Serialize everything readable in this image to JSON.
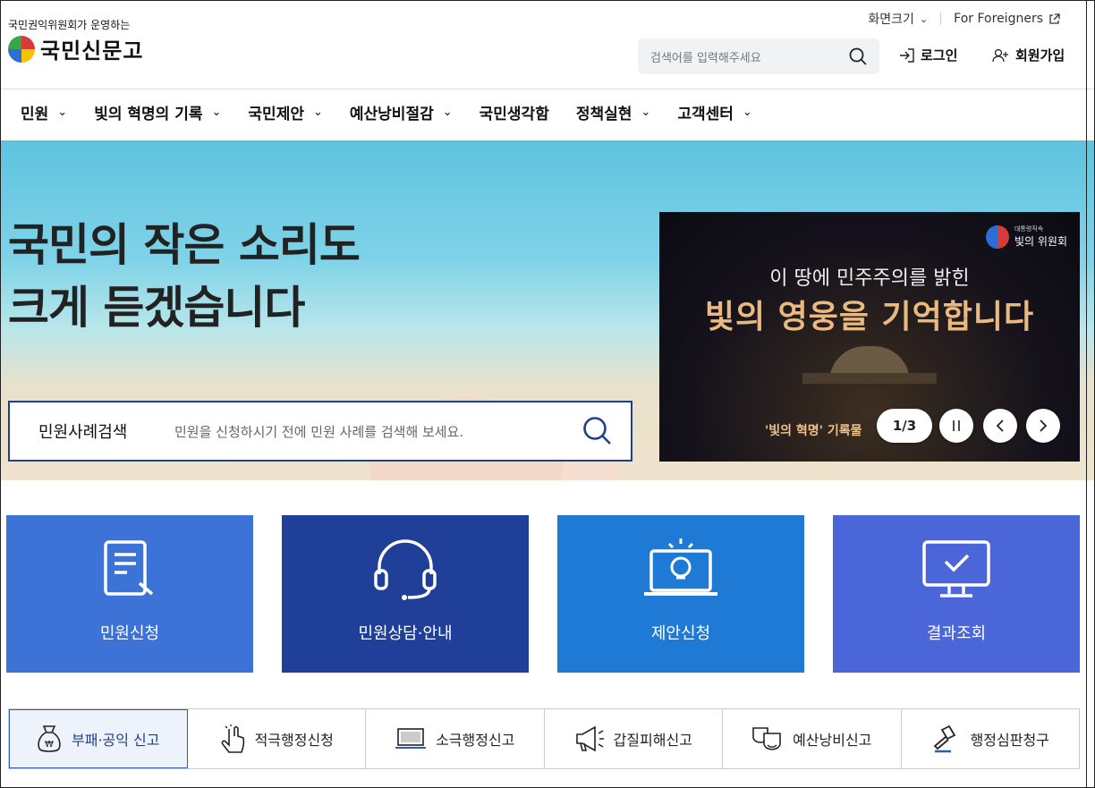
{
  "header": {
    "tagline": "국민권익위원회가 운영하는",
    "site_name": "국민신문고",
    "font_size_label": "화면크기",
    "foreigners_label": "For Foreigners",
    "search_placeholder": "검색어를 입력해주세요",
    "login_label": "로그인",
    "signup_label": "회원가입"
  },
  "nav": {
    "items": [
      {
        "label": "민원"
      },
      {
        "label": "빛의 혁명의 기록"
      },
      {
        "label": "국민제안"
      },
      {
        "label": "예산낭비절감"
      },
      {
        "label": "국민생각함"
      },
      {
        "label": "정책실현"
      },
      {
        "label": "고객센터"
      }
    ]
  },
  "hero": {
    "line1": "국민의 작은 소리도",
    "line2": "크게 듣겠습니다",
    "case_search_label": "민원사례검색",
    "case_search_placeholder": "민원을 신청하시기 전에 민원 사례를 검색해 보세요."
  },
  "banner": {
    "org_small": "대통령직속",
    "org_name": "빛의 위원회",
    "line1": "이 땅에 민주주의를 밝힌",
    "line2": "빛의 영웅을 기억합니다",
    "caption": "'빛의 혁명' 기록물",
    "pager": "1/3"
  },
  "tiles": [
    {
      "label": "민원신청",
      "color": "#3d72d6"
    },
    {
      "label": "민원상담·안내",
      "color": "#1f3f99"
    },
    {
      "label": "제안신청",
      "color": "#1f7ad6"
    },
    {
      "label": "결과조회",
      "color": "#4a66d9"
    }
  ],
  "quick": [
    {
      "label": "부패·공익 신고",
      "icon": "money-bag-icon"
    },
    {
      "label": "적극행정신청",
      "icon": "pointer-hand-icon"
    },
    {
      "label": "소극행정신고",
      "icon": "laptop-icon"
    },
    {
      "label": "갑질피해신고",
      "icon": "megaphone-icon"
    },
    {
      "label": "예산낭비신고",
      "icon": "masks-icon"
    },
    {
      "label": "행정심판청구",
      "icon": "gavel-icon"
    }
  ]
}
